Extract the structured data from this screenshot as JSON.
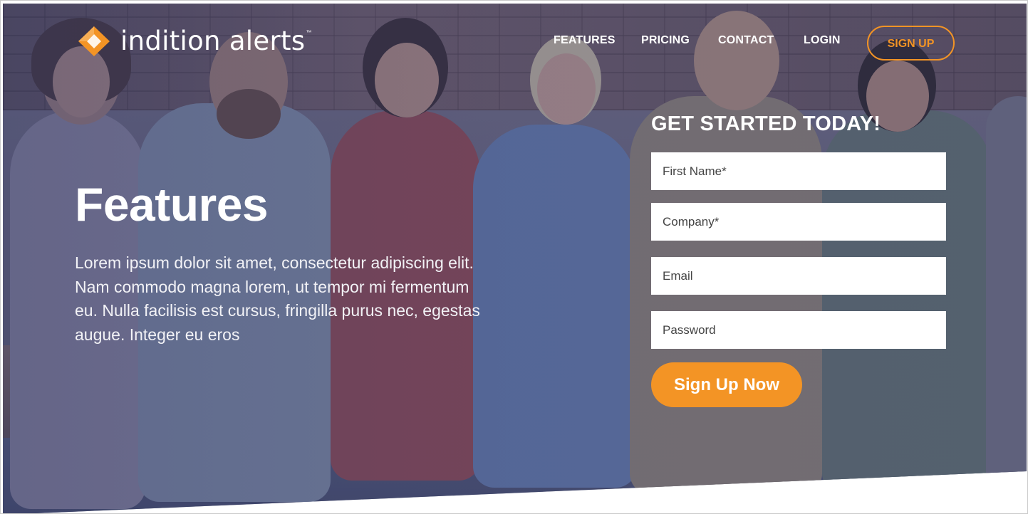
{
  "brand": {
    "name": "indition alerts",
    "trademark": "™",
    "logo_icon": "diamond-logo-icon",
    "accent_color": "#f39425"
  },
  "nav": {
    "items": [
      {
        "label": "FEATURES"
      },
      {
        "label": "PRICING"
      },
      {
        "label": "CONTACT"
      },
      {
        "label": "LOGIN"
      }
    ],
    "signup_label": "SIGN UP"
  },
  "hero": {
    "title": "Features",
    "body": "Lorem ipsum dolor sit amet, consectetur adipiscing elit. Nam commodo magna lorem, ut tempor mi fermentum eu. Nulla facilisis est cursus, fringilla purus nec, egestas augue. Integer eu eros",
    "overlay_color": "#303868"
  },
  "form": {
    "title": "GET STARTED TODAY!",
    "fields": [
      {
        "placeholder": "First Name*",
        "value": ""
      },
      {
        "placeholder": "Company*",
        "value": ""
      },
      {
        "placeholder": "Email",
        "value": ""
      },
      {
        "placeholder": "Password",
        "value": ""
      }
    ],
    "submit_label": "Sign Up Now"
  }
}
